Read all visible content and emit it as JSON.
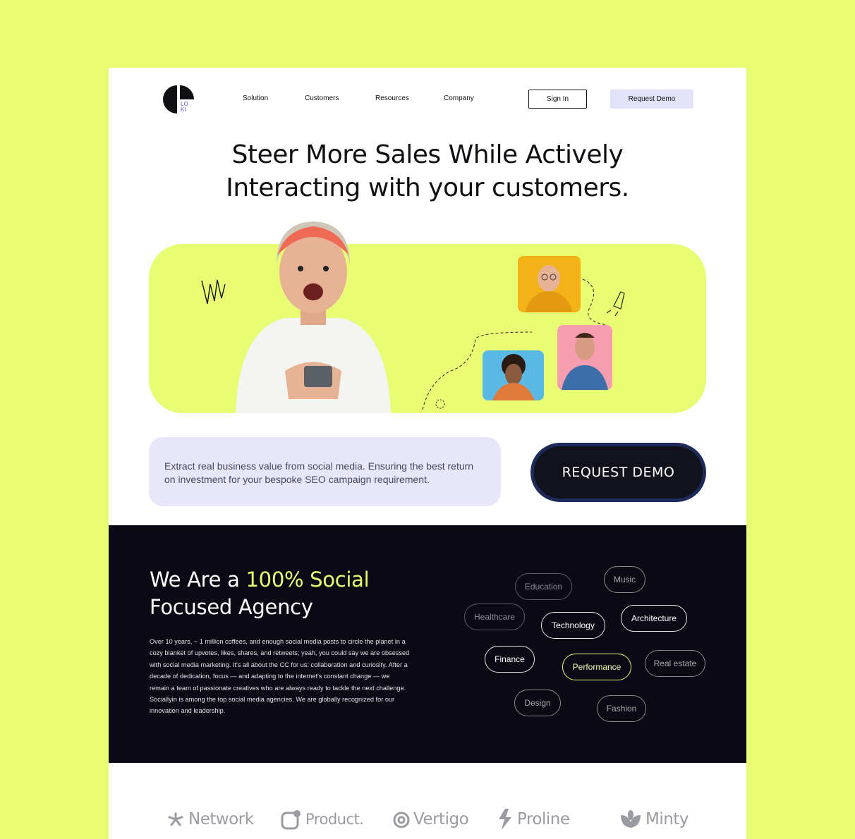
{
  "brand": {
    "logo_line1": "LO",
    "logo_line2": "KI"
  },
  "nav": {
    "solution": "Solution",
    "customers": "Customers",
    "resources": "Resources",
    "company": "Company"
  },
  "header": {
    "signin": "Sign In",
    "request_demo": "Request Demo"
  },
  "hero": {
    "line1": "Steer More Sales While Actively",
    "line2": "Interacting with your customers."
  },
  "info": {
    "text": "Extract real business value from social media. Ensuring the best return on investment for your bespoke SEO campaign requirement.",
    "cta": "REQUEST DEMO"
  },
  "about": {
    "title_part1": "We Are a ",
    "title_accent": "100% Social",
    "title_line2": "Focused Agency",
    "body": "Over 10 years, ~ 1 million coffees, and enough social media posts to circle the planet in a cozy blanket of upvotes, likes, shares, and retweets; yeah, you could say we are obsessed with social media marketing. It's all about the CC for us: collaboration and curiosity. After a decade of dedication, focus — and adapting to the internet's constant change — we remain a team of passionate creatives who are always ready to tackle the next challenge. Sociallyin is among the top social media agencies. We are globally recognized for our innovation and leadership."
  },
  "tags": {
    "education": "Education",
    "music": "Music",
    "healthcare": "Healthcare",
    "technology": "Technology",
    "architecture": "Architecture",
    "finance": "Finance",
    "performance": "Performance",
    "real_estate": "Real estate",
    "design": "Design",
    "fashion": "Fashion"
  },
  "partners": {
    "network": "Network",
    "product": "Product.",
    "vertigo": "Vertigo",
    "proline": "Proline",
    "minty": "Minty"
  },
  "colors": {
    "accent": "#e8fd74",
    "dark": "#0b0a14",
    "lavender": "#e7e6fb"
  }
}
